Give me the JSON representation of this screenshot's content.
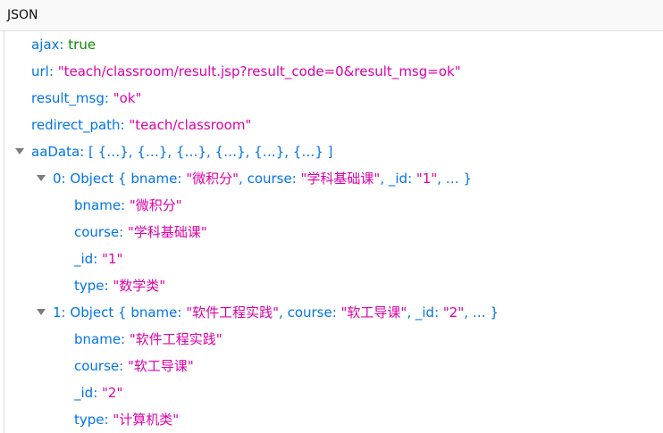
{
  "header": {
    "title": "JSON"
  },
  "rows": {
    "ajax": {
      "key": "ajax:",
      "value": "true"
    },
    "url": {
      "key": "url:",
      "value": "\"teach/classroom/result.jsp?result_code=0&result_msg=ok\""
    },
    "result_msg": {
      "key": "result_msg:",
      "value": "\"ok\""
    },
    "redirect_path": {
      "key": "redirect_path:",
      "value": "\"teach/classroom\""
    },
    "aaData": {
      "key": "aaData:",
      "preview": "[ {…}, {…}, {…}, {…}, {…}, {…} ]"
    },
    "item0": {
      "key": "0:",
      "preview": {
        "head": "Object { bname: ",
        "v1": "\"微积分\"",
        "mid1": ", course: ",
        "v2": "\"学科基础课\"",
        "mid2": ", _id: ",
        "v3": "\"1\"",
        "tail": ", … }"
      },
      "fields": [
        {
          "key": "bname:",
          "value": "\"微积分\""
        },
        {
          "key": "course:",
          "value": "\"学科基础课\""
        },
        {
          "key": "_id:",
          "value": "\"1\""
        },
        {
          "key": "type:",
          "value": "\"数学类\""
        }
      ]
    },
    "item1": {
      "key": "1:",
      "preview": {
        "head": "Object { bname: ",
        "v1": "\"软件工程实践\"",
        "mid1": ", course: ",
        "v2": "\"软工导课\"",
        "mid2": ", _id: ",
        "v3": "\"2\"",
        "tail": ", … }"
      },
      "fields": [
        {
          "key": "bname:",
          "value": "\"软件工程实践\""
        },
        {
          "key": "course:",
          "value": "\"软工导课\""
        },
        {
          "key": "_id:",
          "value": "\"2\""
        },
        {
          "key": "type:",
          "value": "\"计算机类\""
        }
      ]
    }
  }
}
